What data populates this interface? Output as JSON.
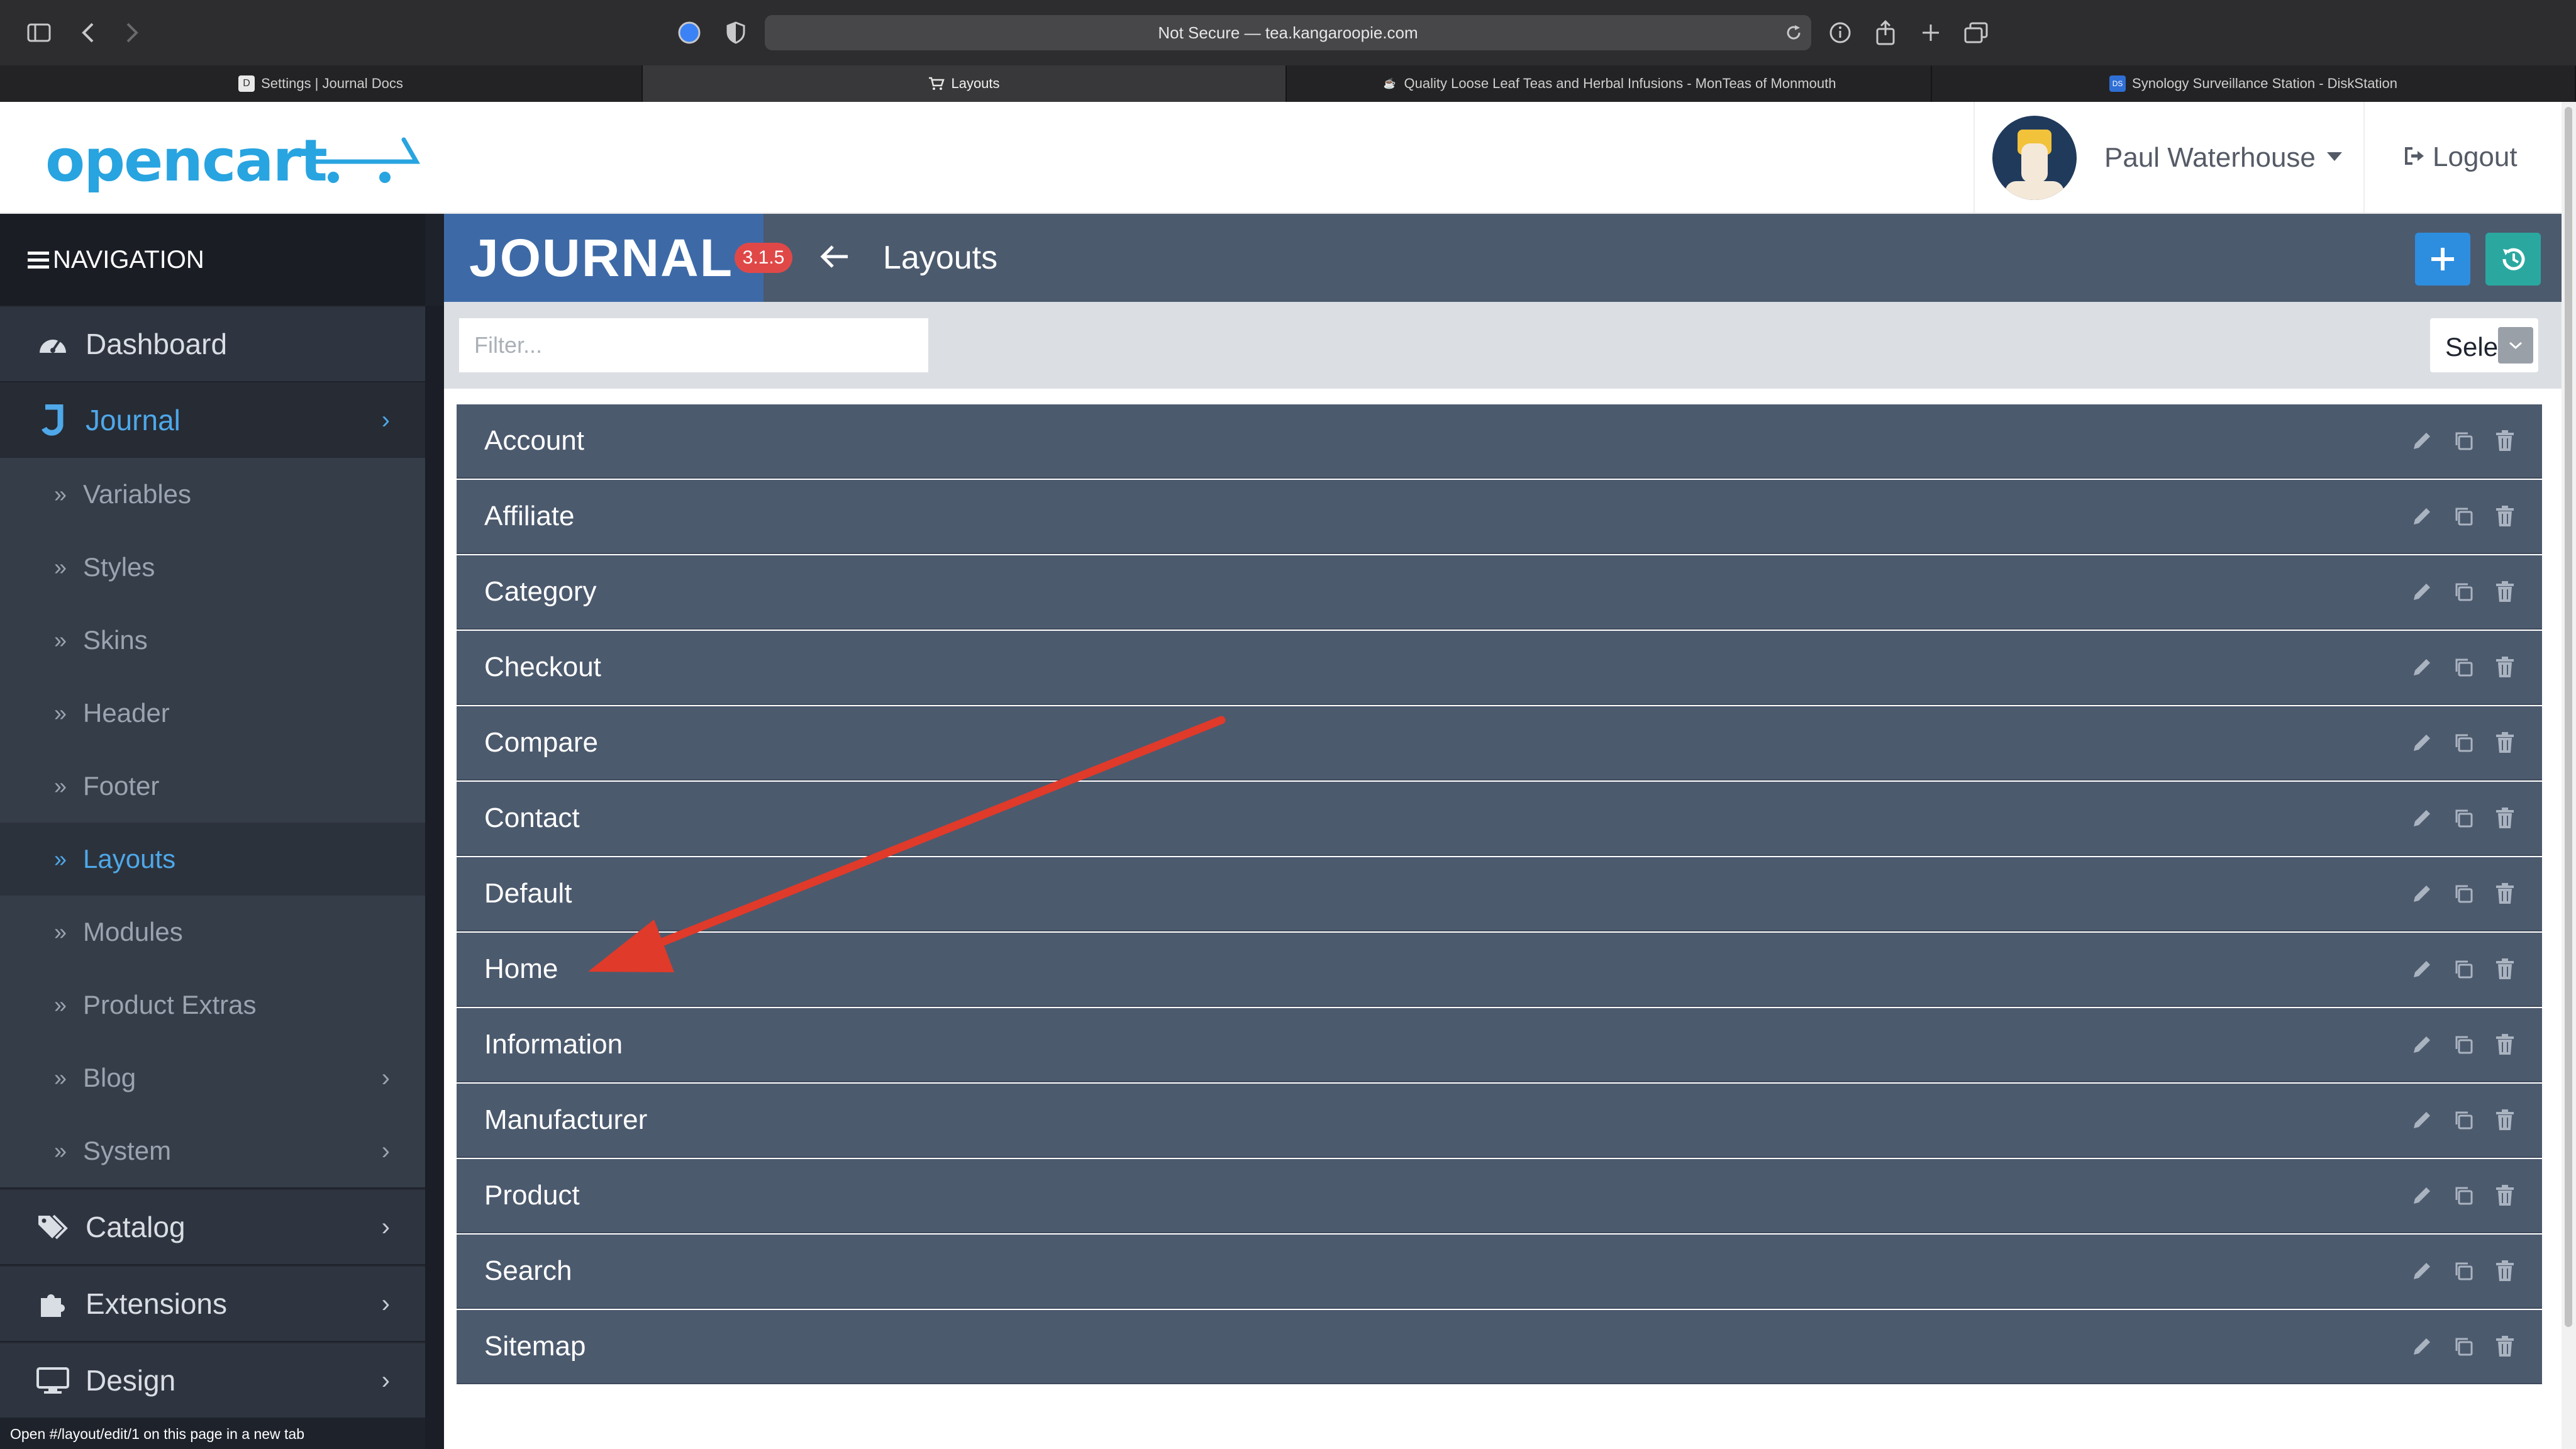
{
  "browser": {
    "url_text": "Not Secure — tea.kangaroopie.com",
    "tabs": [
      {
        "label": "Settings | Journal Docs",
        "favicon": "journal-docs-icon"
      },
      {
        "label": "Layouts",
        "favicon": "cart-icon"
      },
      {
        "label": "Quality Loose Leaf Teas and Herbal Infusions - MonTeas of Monmouth",
        "favicon": "tea-icon"
      },
      {
        "label": "Synology Surveillance Station - DiskStation",
        "favicon": "synology-icon"
      }
    ]
  },
  "header": {
    "logo_text": "opencart",
    "user_name": "Paul Waterhouse",
    "logout_label": "Logout"
  },
  "sidebar": {
    "nav_title": "NAVIGATION",
    "items": [
      {
        "label": "Dashboard",
        "icon": "dashboard-icon"
      },
      {
        "label": "Journal",
        "icon": "journal-icon"
      },
      {
        "label": "Catalog",
        "icon": "tags-icon"
      },
      {
        "label": "Extensions",
        "icon": "puzzle-icon"
      },
      {
        "label": "Design",
        "icon": "monitor-icon"
      }
    ],
    "journal_subitems": [
      {
        "label": "Variables"
      },
      {
        "label": "Styles"
      },
      {
        "label": "Skins"
      },
      {
        "label": "Header"
      },
      {
        "label": "Footer"
      },
      {
        "label": "Layouts",
        "active": true
      },
      {
        "label": "Modules"
      },
      {
        "label": "Product Extras"
      },
      {
        "label": "Blog",
        "has_children": true
      },
      {
        "label": "System",
        "has_children": true
      }
    ]
  },
  "journal_bar": {
    "logo_text": "JOURNAL",
    "version": "3.1.5",
    "title": "Layouts"
  },
  "filter": {
    "placeholder": "Filter...",
    "select_value": "Sele"
  },
  "layouts": [
    "Account",
    "Affiliate",
    "Category",
    "Checkout",
    "Compare",
    "Contact",
    "Default",
    "Home",
    "Information",
    "Manufacturer",
    "Product",
    "Search",
    "Sitemap"
  ],
  "status_bar": "Open #/layout/edit/1 on this page in a new tab",
  "colors": {
    "accent": "#4ea8e9",
    "row_bg": "#4c5a6e",
    "annotation_arrow": "#e03a2a",
    "version_badge": "#e04848"
  }
}
